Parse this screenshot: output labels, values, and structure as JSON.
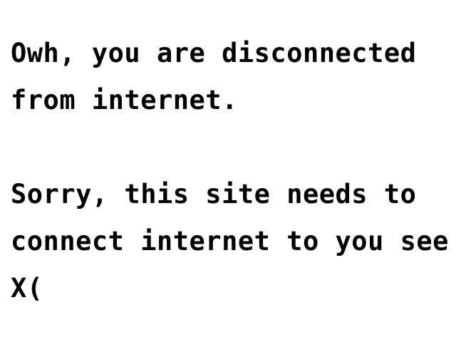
{
  "offline_page": {
    "heading": "Owh, you are disconnected from internet.",
    "body": "Sorry, this site needs to connect internet to you see X("
  }
}
